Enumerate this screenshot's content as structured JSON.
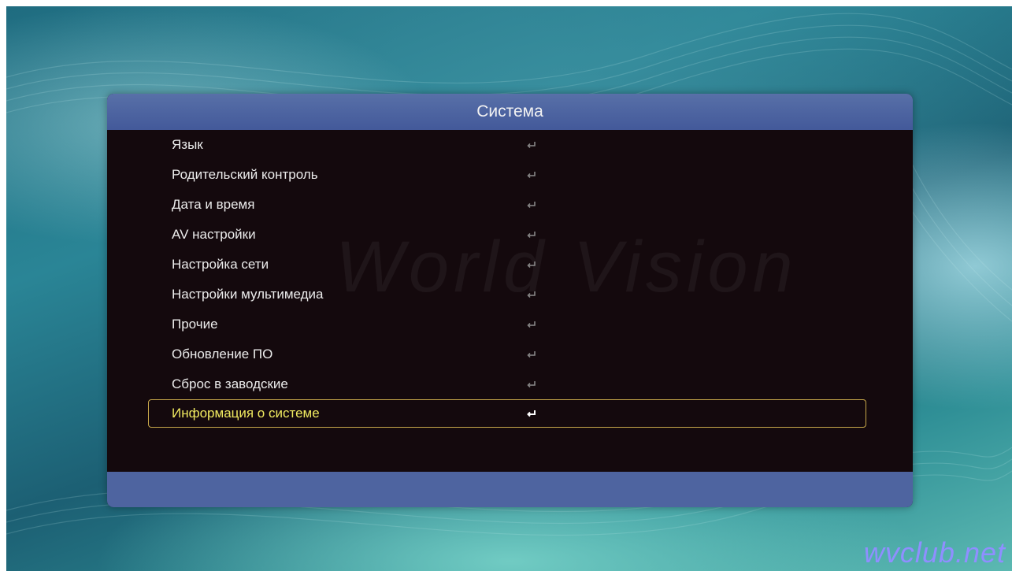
{
  "menu": {
    "title": "Система",
    "items": [
      {
        "label": "Язык",
        "icon": "enter-icon",
        "selected": false
      },
      {
        "label": "Родительский контроль",
        "icon": "enter-icon",
        "selected": false
      },
      {
        "label": "Дата и время",
        "icon": "enter-icon",
        "selected": false
      },
      {
        "label": "AV настройки",
        "icon": "enter-icon",
        "selected": false
      },
      {
        "label": "Настройка сети",
        "icon": "enter-icon",
        "selected": false
      },
      {
        "label": "Настройки мультимедиа",
        "icon": "enter-icon",
        "selected": false
      },
      {
        "label": "Прочие",
        "icon": "enter-icon",
        "selected": false
      },
      {
        "label": "Обновление ПО",
        "icon": "enter-icon",
        "selected": false
      },
      {
        "label": "Сброс в заводские",
        "icon": "enter-icon",
        "selected": false
      },
      {
        "label": "Информация о системе",
        "icon": "enter-icon",
        "selected": true
      }
    ]
  },
  "watermark": {
    "logo": "wvclub.net",
    "panel_text": "World Vision"
  },
  "colors": {
    "header": "#4a60a0",
    "panel": "#14090d",
    "selected_text": "#f0ea60",
    "selected_border": "#c8a84a",
    "logo": "#8f8fff"
  }
}
